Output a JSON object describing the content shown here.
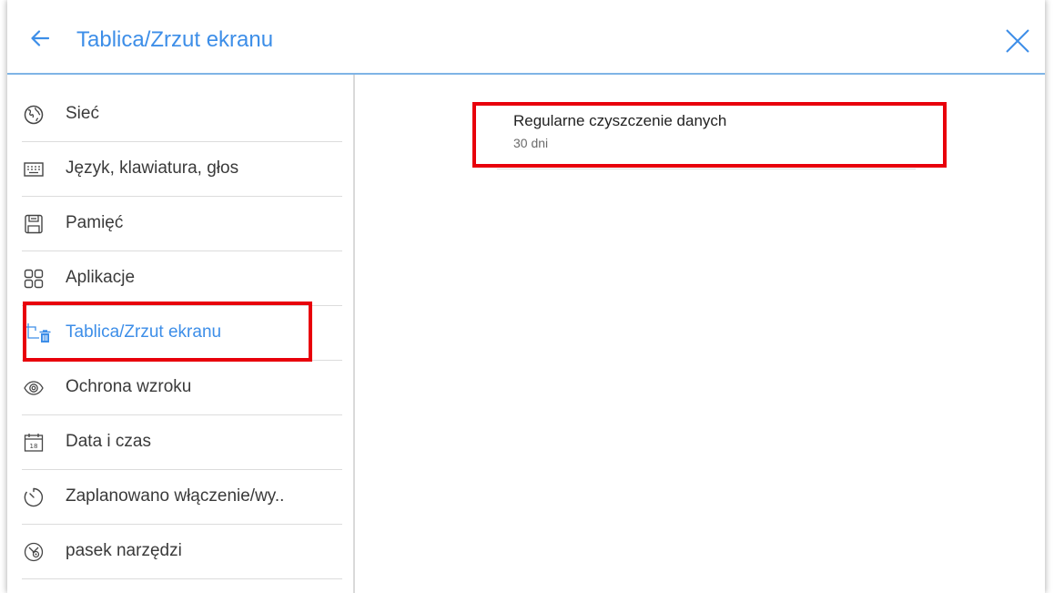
{
  "header": {
    "title": "Tablica/Zrzut ekranu",
    "back_icon": "arrow-left-icon",
    "close_icon": "close-icon",
    "accent_color": "#3d8ee8"
  },
  "sidebar": {
    "items": [
      {
        "label": "Sieć",
        "icon": "globe-icon",
        "active": false
      },
      {
        "label": "Język, klawiatura, głos",
        "icon": "keyboard-icon",
        "active": false
      },
      {
        "label": "Pamięć",
        "icon": "storage-icon",
        "active": false
      },
      {
        "label": "Aplikacje",
        "icon": "apps-grid-icon",
        "active": false
      },
      {
        "label": "Tablica/Zrzut ekranu",
        "icon": "crop-trash-icon",
        "active": true
      },
      {
        "label": "Ochrona wzroku",
        "icon": "eye-icon",
        "active": false
      },
      {
        "label": "Data i czas",
        "icon": "calendar-icon",
        "active": false
      },
      {
        "label": "Zaplanowano włączenie/wy..",
        "icon": "timer-icon",
        "active": false
      },
      {
        "label": "pasek narzędzi",
        "icon": "toolbar-icon",
        "active": false
      }
    ]
  },
  "main": {
    "setting": {
      "title": "Regularne czyszczenie danych",
      "value": "30 dni"
    }
  },
  "highlight_color": "#e8000b"
}
